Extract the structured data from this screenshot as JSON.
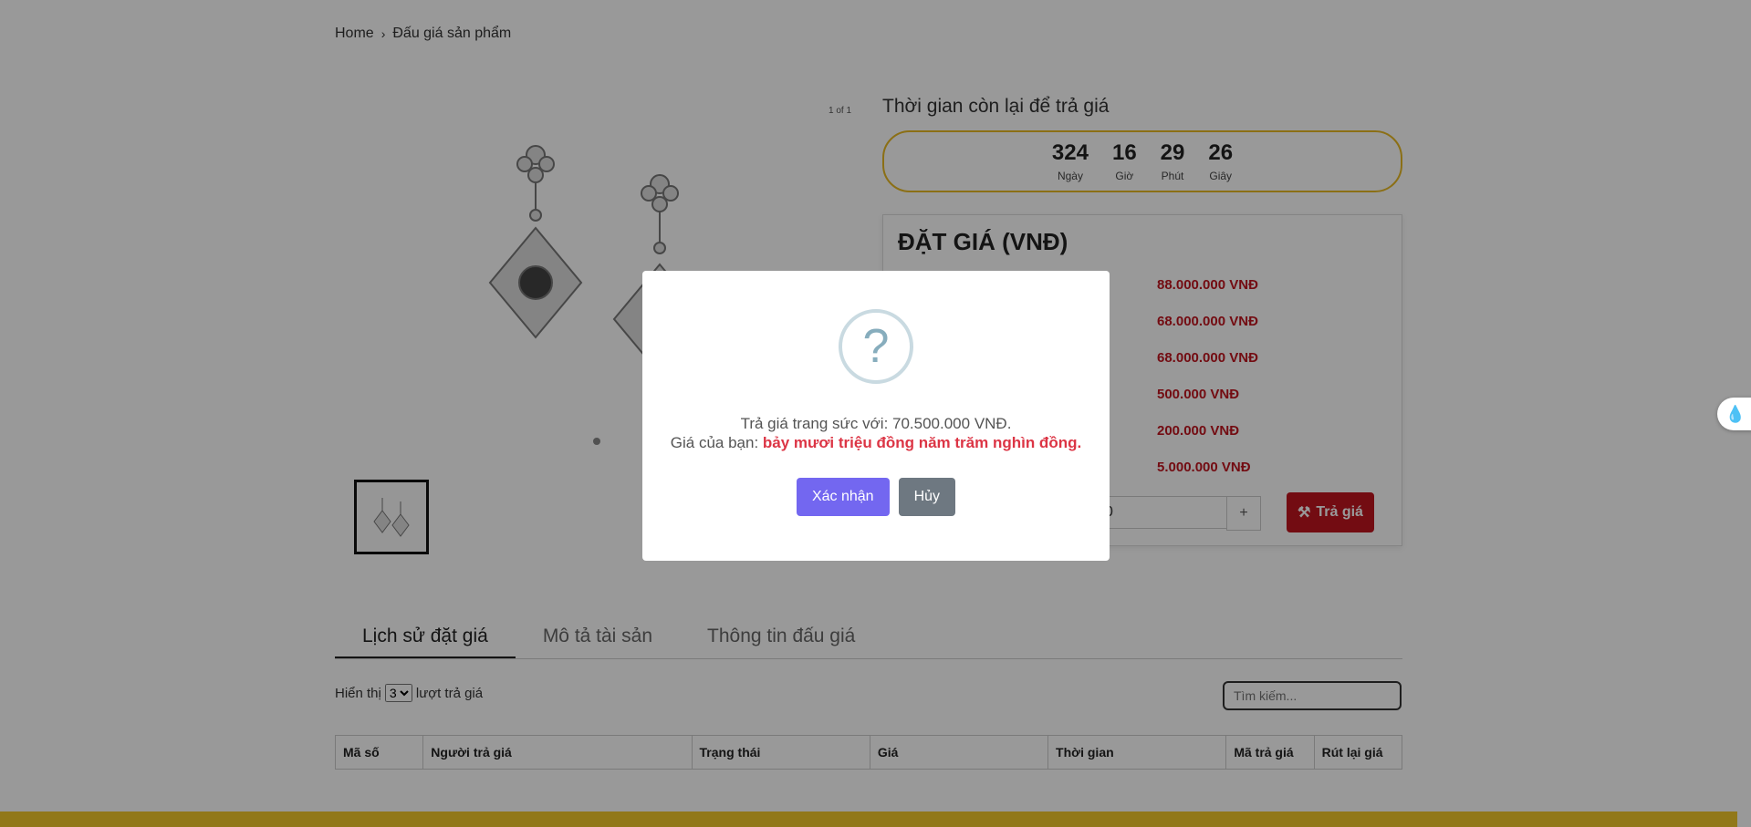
{
  "breadcrumb": {
    "home": "Home",
    "current": "Đấu giá sản phẩm"
  },
  "gallery": {
    "counter": "1 of 1"
  },
  "timer": {
    "title": "Thời gian còn lại để trả giá",
    "units": [
      {
        "value": "324",
        "label": "Ngày"
      },
      {
        "value": "16",
        "label": "Giờ"
      },
      {
        "value": "29",
        "label": "Phút"
      },
      {
        "value": "26",
        "label": "Giây"
      }
    ]
  },
  "bid_panel": {
    "title": "ĐẶT GIÁ (VNĐ)",
    "values": [
      "88.000.000 VNĐ",
      "68.000.000 VNĐ",
      "68.000.000 VNĐ",
      "500.000 VNĐ",
      "200.000 VNĐ",
      "5.000.000 VNĐ"
    ],
    "quantity_value": "0",
    "plus_label": "+",
    "bid_button": "Trả giá"
  },
  "tabs": [
    "Lịch sử đặt giá",
    "Mô tả tài sản",
    "Thông tin đấu giá"
  ],
  "history": {
    "show_prefix": "Hiển thị",
    "show_value": "3",
    "show_suffix": "lượt trả giá",
    "search_placeholder": "Tìm kiếm...",
    "columns": [
      "Mã số",
      "Người trả giá",
      "Trạng thái",
      "Giá",
      "Thời gian",
      "Mã trả giá",
      "Rút lại giá"
    ]
  },
  "modal": {
    "icon": "?",
    "line1": "Trả giá trang sức với: 70.500.000 VNĐ.",
    "line2_prefix": "Giá của bạn: ",
    "line2_words": "bảy mươi triệu đồng năm trăm nghìn đồng.",
    "confirm": "Xác nhận",
    "cancel": "Hủy"
  },
  "colors": {
    "accent_red": "#c0141e",
    "timer_border": "#e8b923",
    "confirm": "#7367f0",
    "cancel": "#6e7881",
    "footer": "#f2c82a"
  }
}
